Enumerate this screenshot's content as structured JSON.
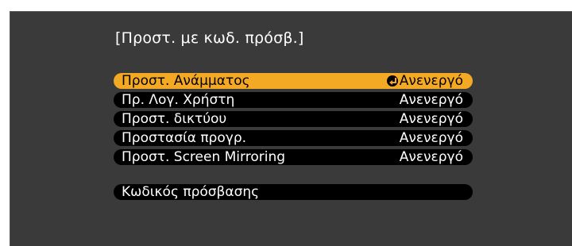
{
  "menu": {
    "title": "[Προστ. με κωδ. πρόσβ.]",
    "items": [
      {
        "label": "Προστ. Ανάμματος",
        "value": "Ανενεργό",
        "selected": true,
        "icon": "enter-icon"
      },
      {
        "label": "Πρ. Λογ. Χρήστη",
        "value": "Ανενεργό",
        "selected": false
      },
      {
        "label": "Προστ. δικτύου",
        "value": "Ανενεργό",
        "selected": false
      },
      {
        "label": "Προστασία προγρ.",
        "value": "Ανενεργό",
        "selected": false
      },
      {
        "label": "Προστ. Screen Mirroring",
        "value": "Ανενεργό",
        "selected": false
      }
    ],
    "password": {
      "label": "Κωδικός πρόσβασης"
    }
  },
  "colors": {
    "background": "#3a3a3a",
    "row": "#000000",
    "highlight": "#f4a925",
    "text": "#ffffff"
  }
}
